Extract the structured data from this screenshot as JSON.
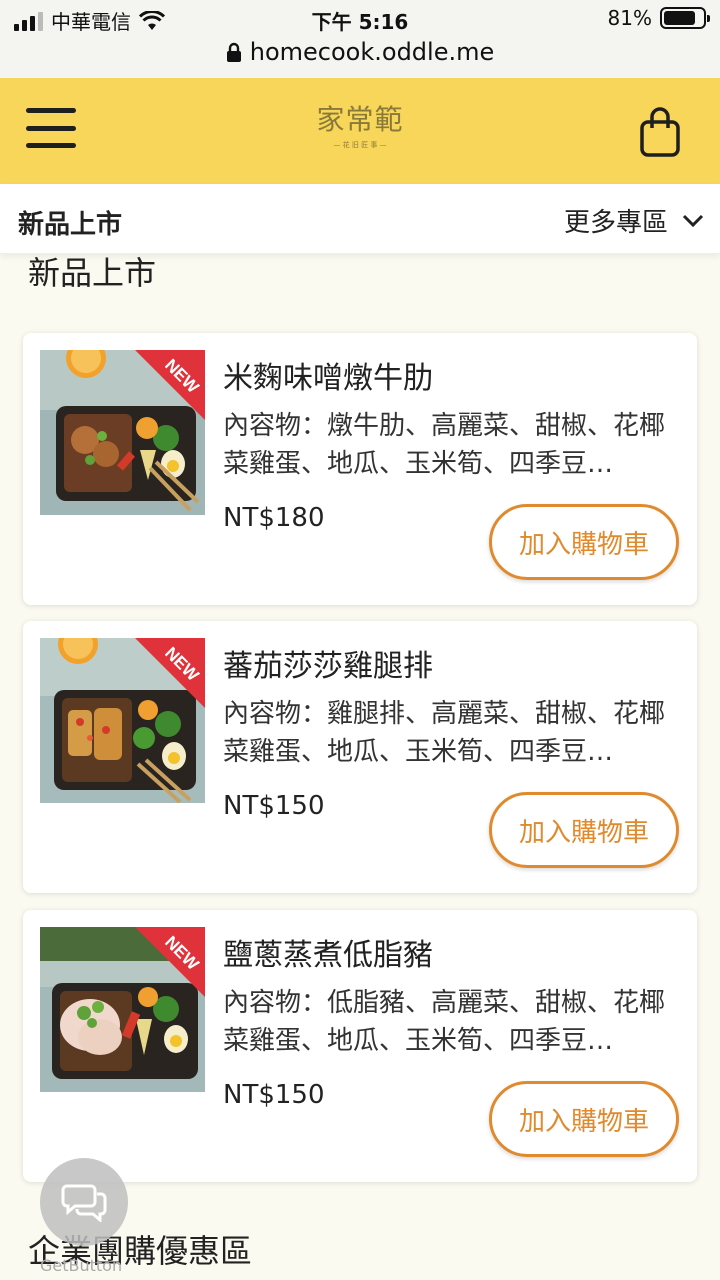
{
  "status": {
    "carrier": "中華電信",
    "time": "下午 5:16",
    "battery": "81%",
    "battery_level": 0.81,
    "url": "homecook.oddle.me"
  },
  "header": {
    "logo_text": "家常範",
    "logo_sub": "— 花 旧 匠 事 —"
  },
  "subnav": {
    "current": "新品上市",
    "more": "更多專區"
  },
  "section": {
    "title": "新品上市"
  },
  "products": [
    {
      "name": "米麴味噌燉牛肋",
      "desc": "內容物：燉牛肋、高麗菜、甜椒、花椰菜雞蛋、地瓜、玉米筍、四季豆…",
      "price": "NT$180",
      "button": "加入購物車",
      "badge": "NEW"
    },
    {
      "name": "蕃茄莎莎雞腿排",
      "desc": "內容物：雞腿排、高麗菜、甜椒、花椰菜雞蛋、地瓜、玉米筍、四季豆…",
      "price": "NT$150",
      "button": "加入購物車",
      "badge": "NEW"
    },
    {
      "name": "鹽蔥蒸煮低脂豬",
      "desc": "內容物：低脂豬、高麗菜、甜椒、花椰菜雞蛋、地瓜、玉米筍、四季豆…",
      "price": "NT$150",
      "button": "加入購物車",
      "badge": "NEW"
    }
  ],
  "section2": {
    "title": "企業團購優惠區"
  },
  "chat": {
    "label": "GetButton"
  },
  "colors": {
    "header_bg": "#f7d65a",
    "accent": "#e08a2e",
    "page_bg": "#fbfaf0",
    "badge_red": "#e0323a"
  }
}
